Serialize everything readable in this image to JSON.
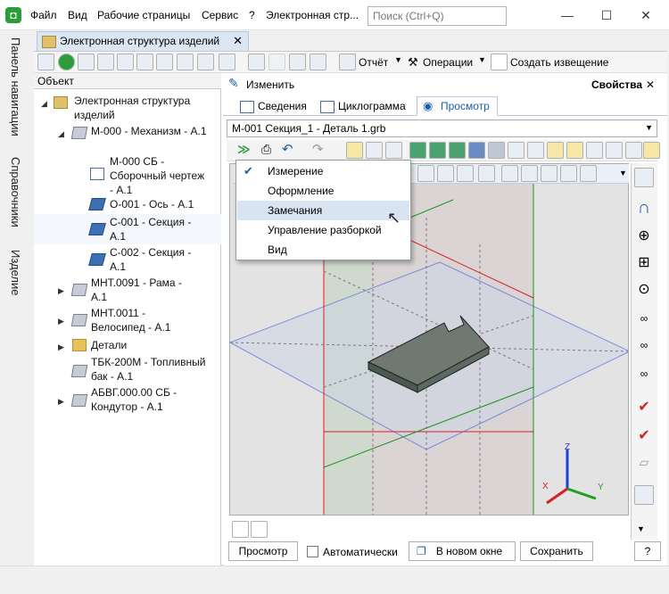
{
  "titlebar": {
    "menus": [
      "Файл",
      "Вид",
      "Рабочие страницы",
      "Сервис",
      "?",
      "Электронная стр..."
    ],
    "search_placeholder": "Поиск (Ctrl+Q)"
  },
  "sidenav": {
    "tabs": [
      "Панель навигации",
      "Справочники",
      "Изделие"
    ]
  },
  "doc_tab": {
    "title": "Электронная структура изделий"
  },
  "toolbar1": {
    "report": "Отчёт",
    "operations": "Операции",
    "create_notice": "Создать извещение"
  },
  "left": {
    "header": "Объект",
    "tree": [
      {
        "label": "Электронная структура изделий"
      },
      {
        "label": "М-000 - Механизм - А.1"
      },
      {
        "label": "М-000 СБ - Сборочный чертеж - А.1"
      },
      {
        "label": "О-001 - Ось - А.1"
      },
      {
        "label": "С-001 - Секция - А.1"
      },
      {
        "label": "С-002 - Секция - А.1"
      },
      {
        "label": "МНТ.0091 - Рама - А.1"
      },
      {
        "label": "МНТ.0011 - Велосипед - А.1"
      },
      {
        "label": "Детали"
      },
      {
        "label": "ТБК-200М - Топливный бак - А.1"
      },
      {
        "label": "АБВГ.000.00 СБ - Кондутор - А.1"
      }
    ]
  },
  "right": {
    "edit": "Изменить",
    "props": "Свойства",
    "tabs": [
      "Сведения",
      "Циклограмма",
      "Просмотр"
    ],
    "file": "М-001 Секция_1 - Деталь 1.grb"
  },
  "popup": {
    "items": [
      "Измерение",
      "Оформление",
      "Замечания",
      "Управление разборкой",
      "Вид"
    ]
  },
  "axes": {
    "x": "X",
    "y": "Y",
    "z": "Z"
  },
  "bottom": {
    "view": "Просмотр",
    "auto": "Автоматически",
    "new_window": "В новом окне",
    "save": "Сохранить",
    "help": "?"
  },
  "colors": {
    "accent": "#1c5ea8",
    "popup_highlight": "#d9e4f2"
  }
}
